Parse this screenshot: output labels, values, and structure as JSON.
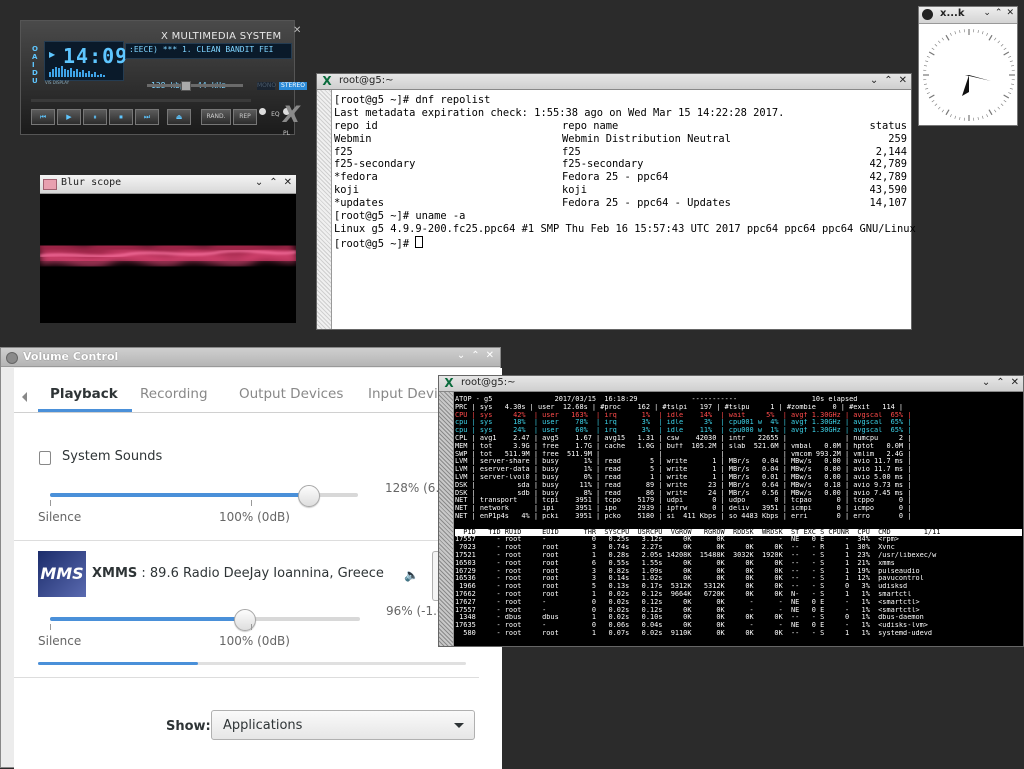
{
  "xmms": {
    "brand": "X MULTIMEDIA SYSTEM",
    "time": "14:09",
    "side_letters": "O\nA\nI\nD\nU",
    "vis_label": "VIS DISPLAY",
    "title_scroll": ":EECE)  ***  1. CLEAN BANDIT FEI",
    "kbps": "128 kbps",
    "khz": "44 kHz",
    "mono": "MONO",
    "stereo": "STEREO",
    "eq": "EQ",
    "pl": "PL",
    "buttons": [
      "⏮",
      "▶",
      "⏸",
      "⏹",
      "⏭",
      "⏏"
    ],
    "rand": "RAND.",
    "rep": "REP"
  },
  "blur": {
    "title": "Blur scope"
  },
  "term1": {
    "title": "root@g5:~",
    "lines": [
      "[root@g5 ~]# dnf repolist",
      "Last metadata expiration check: 1:55:38 ago on Wed Mar 15 14:22:28 2017."
    ],
    "table": [
      [
        "repo id",
        "repo name",
        "status"
      ],
      [
        "Webmin",
        "Webmin Distribution Neutral",
        "259"
      ],
      [
        "f25",
        "f25",
        "2,144"
      ],
      [
        "f25-secondary",
        "f25-secondary",
        "42,789"
      ],
      [
        "*fedora",
        "Fedora 25 - ppc64",
        "42,789"
      ],
      [
        "koji",
        "koji",
        "43,590"
      ],
      [
        "*updates",
        "Fedora 25 - ppc64 - Updates",
        "14,107"
      ]
    ],
    "tail": [
      "[root@g5 ~]# uname -a",
      "Linux g5 4.9.9-200.fc25.ppc64 #1 SMP Thu Feb 16 15:57:43 UTC 2017 ppc64 ppc64 ppc64 GNU/Linux",
      "[root@g5 ~]# "
    ]
  },
  "clock": {
    "title": "x...k"
  },
  "volume": {
    "title": "Volume Control",
    "tabs": [
      "Playback",
      "Recording",
      "Output Devices",
      "Input Devic"
    ],
    "system_sounds": {
      "label": "System Sounds",
      "percent": "128% (6.47",
      "silence": "Silence",
      "hundred": "100% (0dB)",
      "level": 1.28
    },
    "xmms_stream": {
      "app": "XMMS",
      "desc": " : 89.6 Radio DeeJay Ioannina, Greece",
      "percent": "96% (-1.06",
      "silence": "Silence",
      "hundred": "100% (0dB)",
      "level": 0.96
    },
    "show_label": "Show:",
    "show_value": "Applications"
  },
  "term2": {
    "title": "root@g5:~",
    "lines": [
      "ATOP - g5               2017/03/15  16:18:29             -----------                  10s elapsed",
      "PRC | sys   4.30s | user  12.68s | #proc    162 | #tslpi   197 | #tslpu     1 | #zombie    0 | #exit   114 |",
      "CPU | sys     42%  | user   163%  | irq      1%  | idle    14%  | wait     5%  | avgf 1.30GHz | avgscal  65% |",
      "cpu | sys     18%  | user    78%  | irq      3%  | idle     3%  | cpu001 w  4% | avgf 1.30GHz | avgscal  65% |",
      "cpu | sys     24%  | user    60%  | irq      3%  | idle    11%  | cpu000 w  1% | avgf 1.30GHz | avgscal  65% |",
      "CPL | avg1    2.47 | avg5    1.67 | avg15   1.31 | csw    42030 | intr   22655 |              | numcpu     2 |",
      "MEM | tot     3.9G | free    1.7G | cache   1.0G | buff  105.2M | slab  521.6M | vmbal   0.0M | hptot   0.0M |",
      "SWP | tot   511.9M | free  511.9M |              |              |              | vmcom 993.2M | vmlim   2.4G |",
      "LVM | server-share | busy      1% | read       5 | write      1 | MBr/s   0.04 | MBw/s   0.00 | avio 11.7 ms |",
      "LVM | eserver-data | busy      1% | read       5 | write      1 | MBr/s   0.04 | MBw/s   0.00 | avio 11.7 ms |",
      "LVM | server-lvol0 | busy      0% | read       1 | write      1 | MBr/s   0.01 | MBw/s   0.00 | avio 5.00 ms |",
      "DSK |          sda | busy     11% | read      89 | write     23 | MBr/s   0.64 | MBw/s   0.18 | avio 9.73 ms |",
      "DSK |          sdb | busy      8% | read      86 | write     24 | MBr/s   0.56 | MBw/s   0.00 | avio 7.45 ms |",
      "NET | transport    | tcpi    3951 | tcpo    5179 | udpi       0 | udpo       0 | tcpao      0 | tcppo      0 |",
      "NET | network      | ipi     3951 | ipo     2939 | ipfrw      0 | deliv   3951 | icmpi      0 | icmpo      0 |",
      "NET | enP1p4s   4% | pcki    3951 | pcko    5180 | si  411 Kbps | so 4483 Kbps | erri       0 | erro       0 |",
      "",
      "  PID   TID RUID     EUID      THR  SYSCPU  USRCPU  VGROW   RGROW  RDDSK  WRDSK  ST EXC S CPUNR  CPU  CMD        1/11",
      "17557     - root     -           0   0.25s   3.12s     0K      0K      -      -  NE   0 E     -  34%  <rpm>",
      " 7023     - root     root        3   0.74s   2.27s     0K      0K     0K     0K  --   - R     1  30%  Xvnc",
      "17521     - root     root        1   0.28s   2.05s 14208K  15488K  3032K  1920K  --   - S     1  23%  /usr/libexec/w",
      "16503     - root     root        6   0.55s   1.55s     0K      0K     0K     0K  --   - S     1  21%  xmms",
      "16729     - root     root        3   0.82s   1.09s     0K      0K     0K     0K  --   - S     1  19%  pulseaudio",
      "16536     - root     root        3   0.14s   1.02s     0K      0K     0K     0K  --   - S     1  12%  pavucontrol",
      " 1966     - root     root        5   0.13s   0.17s  5312K   5312K     0K     0K  --   - S     0   3%  udisksd",
      "17662     - root     root        1   0.02s   0.12s  9664K   6720K     0K     0K  N-   - S     1   1%  smartctl",
      "17627     - root     -           0   0.02s   0.12s     0K      0K      -      -  NE   0 E     -   1%  <smartctl>",
      "17557     - root     -           0   0.02s   0.12s     0K      0K      -      -  NE   0 E     -   1%  <smartctl>",
      " 1348     - dbus     dbus        1   0.02s   0.10s     0K      0K     0K     0K  --   - S     0   1%  dbus-daemon",
      "17635     - root     -           0   0.06s   0.04s     0K      0K      -      -  NE   0 E     -   1%  <udisks-lvm>",
      "  580     - root     root        1   0.07s   0.02s  9110K      0K     0K     0K  --   - S     1   1%  systemd-udevd"
    ]
  }
}
